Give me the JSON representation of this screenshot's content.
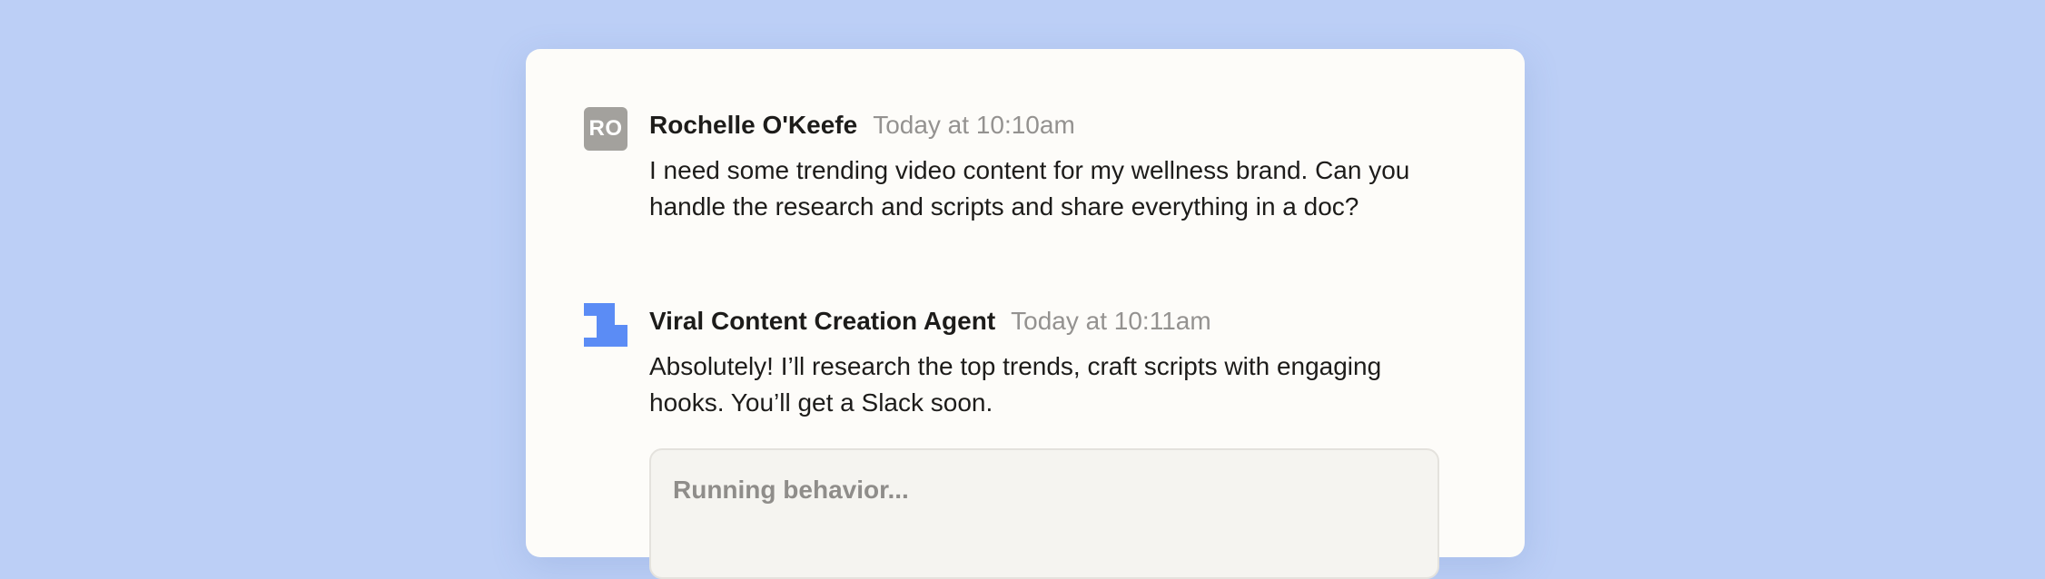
{
  "messages": [
    {
      "avatar_initials": "RO",
      "sender": "Rochelle O'Keefe",
      "timestamp": "Today at 10:10am",
      "text": "I need some trending video content for my wellness brand. Can you handle the research and scripts and share everything in a doc?"
    },
    {
      "avatar_icon": "agent-logo-icon",
      "sender": "Viral Content Creation Agent",
      "timestamp": "Today at 10:11am",
      "text": "Absolutely! I’ll research the top trends, craft scripts with engaging hooks. You’ll get a Slack soon."
    }
  ],
  "behavior": {
    "status_text": "Running behavior..."
  },
  "colors": {
    "background": "#bccff6",
    "card": "#fdfcf9",
    "user_avatar": "#a3a19d",
    "agent_avatar": "#5b8cf5",
    "timestamp": "#949290"
  }
}
